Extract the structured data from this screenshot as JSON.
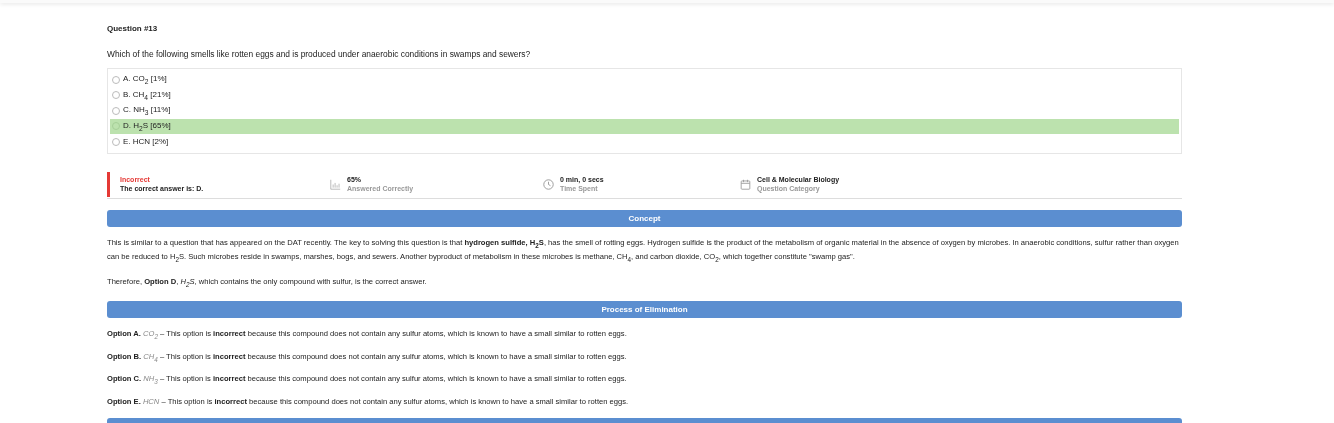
{
  "question": {
    "number": "Question #13",
    "text": "Which of the following smells like rotten eggs and is produced under anaerobic conditions in swamps and sewers?"
  },
  "options": [
    {
      "label": "A. CO$_{2}$ [1%]",
      "checked": false,
      "correct": false
    },
    {
      "label": "B. CH$_{4}$ [21%]",
      "checked": false,
      "correct": false
    },
    {
      "label": "C. NH$_{3}$ [11%]",
      "checked": false,
      "correct": false
    },
    {
      "label": "D. H$_{2}$S [65%]",
      "checked": false,
      "correct": true
    },
    {
      "label": "E. HCN [2%]",
      "checked": false,
      "correct": false
    }
  ],
  "result": {
    "status": "Incorrect",
    "correct_answer": "The correct answer is: D."
  },
  "stats": [
    {
      "kind": "chart",
      "value": "65%",
      "caption": "Answered Correctly"
    },
    {
      "kind": "clock",
      "value": "0 min, 0 secs",
      "caption": "Time Spent"
    },
    {
      "kind": "calendar",
      "value": "Cell & Molecular Biology",
      "caption": "Question Category"
    }
  ],
  "concept": {
    "heading": "Concept",
    "paragraphs": [
      "This is similar to a question that has appeared on the DAT recently. The key to solving this question is that **hydrogen sulfide, H$_{2}$S**, has the smell of rotting eggs. Hydrogen sulfide is the product of the metabolism of organic material in the absence of oxygen by microbes. In anaerobic conditions, sulfur rather than oxygen can be reduced to H$_{2}$S. Such microbes reside in swamps, marshes, bogs, and sewers. Another byproduct of metabolism in these microbes is methane, CH$_{4}$, and carbon dioxide, CO$_{2}$, which together constitute \"swamp gas\".",
      "Therefore, **Option D**, *H$_{2}$S*, which contains the only compound with sulfur, is the correct answer."
    ]
  },
  "elimination": {
    "heading": "Process of Elimination",
    "items": [
      {
        "option": "Option A.",
        "formula": "CO$_{2}$",
        "text": " – This option is **incorrect** because this compound does not contain any sulfur atoms, which is known to have a small similar to rotten eggs."
      },
      {
        "option": "Option B.",
        "formula": "CH$_{4}$",
        "text": " – This option is **incorrect** because this compound does not contain any sulfur atoms, which is known to have a small similar to rotten eggs."
      },
      {
        "option": "Option C.",
        "formula": "NH$_{3}$",
        "text": " – This option is **incorrect** because this compound does not contain any sulfur atoms, which is known to have a small similar to rotten eggs."
      },
      {
        "option": "Option E.",
        "formula": "HCN",
        "text": " – This option is **incorrect** because this compound does not contain any sulfur atoms, which is known to have a small similar to rotten eggs."
      }
    ]
  }
}
